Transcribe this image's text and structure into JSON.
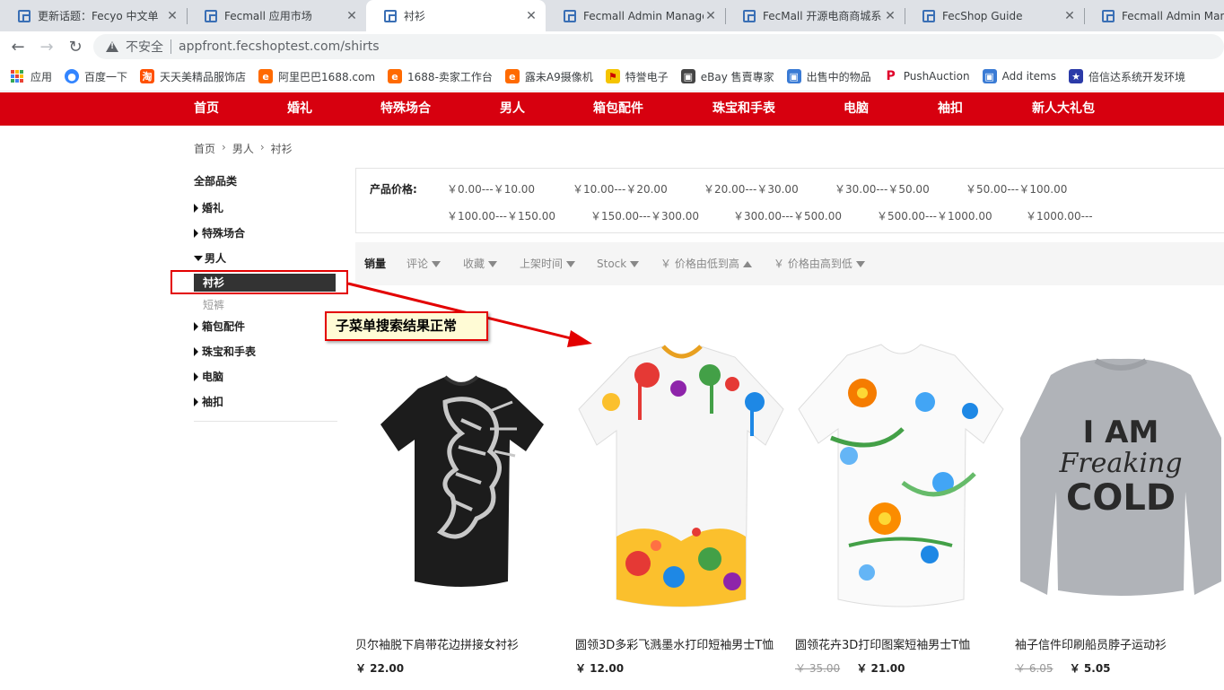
{
  "browser": {
    "tabs": [
      {
        "title": "更新话题：Fecyo 中文单",
        "active": false
      },
      {
        "title": "Fecmall 应用市场",
        "active": false
      },
      {
        "title": "衬衫",
        "active": true
      },
      {
        "title": "Fecmall Admin Manage",
        "active": false
      },
      {
        "title": "FecMall 开源电商商城系",
        "active": false
      },
      {
        "title": "FecShop Guide",
        "active": false
      },
      {
        "title": "Fecmall Admin Mana",
        "active": false
      }
    ],
    "security_label": "不安全",
    "url": "appfront.fecshoptest.com/shirts",
    "bookmarks": [
      {
        "label": "应用",
        "icon": "apps-grid-icon"
      },
      {
        "label": "百度一下",
        "icon": "baidu-paw-icon",
        "color": "#3385ff"
      },
      {
        "label": "天天美精品服饰店",
        "icon": "taobao-icon",
        "color": "#ff5000"
      },
      {
        "label": "阿里巴巴1688.com",
        "icon": "alibaba-icon",
        "color": "#ff6a00"
      },
      {
        "label": "1688-卖家工作台",
        "icon": "alibaba-icon",
        "color": "#ff6a00"
      },
      {
        "label": "露未A9摄像机",
        "icon": "alibaba-icon",
        "color": "#ff6a00"
      },
      {
        "label": "特誉电子",
        "icon": "yellow-flag-icon",
        "color": "#f5c400"
      },
      {
        "label": "eBay 售賣專家",
        "icon": "shopping-bag-icon",
        "color": "#444"
      },
      {
        "label": "出售中的物品",
        "icon": "shopping-bag-icon",
        "color": "#3a7bd5"
      },
      {
        "label": "PushAuction",
        "icon": "pushauction-icon",
        "color": "#e0002a"
      },
      {
        "label": "Add items",
        "icon": "shopping-bag-icon",
        "color": "#3a7bd5"
      },
      {
        "label": "倍信达系统开发环境",
        "icon": "star-badge-icon",
        "color": "#2b3aa8"
      }
    ]
  },
  "site_nav": [
    "首页",
    "婚礼",
    "特殊场合",
    "男人",
    "箱包配件",
    "珠宝和手表",
    "电脑",
    "袖扣",
    "新人大礼包"
  ],
  "breadcrumb": [
    "首页",
    "男人",
    "衬衫"
  ],
  "sidebar": {
    "title": "全部品类",
    "items": [
      {
        "label": "婚礼",
        "expanded": false
      },
      {
        "label": "特殊场合",
        "expanded": false
      },
      {
        "label": "男人",
        "expanded": true
      },
      {
        "label": "箱包配件",
        "expanded": false
      },
      {
        "label": "珠宝和手表",
        "expanded": false
      },
      {
        "label": "电脑",
        "expanded": false
      },
      {
        "label": "袖扣",
        "expanded": false
      }
    ],
    "sub_items": [
      {
        "label": "衬衫",
        "active": true
      },
      {
        "label": "短裤",
        "active": false
      }
    ]
  },
  "annotation": {
    "callout_text": "子菜单搜索结果正常",
    "color": "#e30000"
  },
  "price_filter": {
    "label": "产品价格:",
    "options": [
      "￥0.00---￥10.00",
      "￥10.00---￥20.00",
      "￥20.00---￥30.00",
      "￥30.00---￥50.00",
      "￥50.00---￥100.00",
      "￥100.00---￥150.00",
      "￥150.00---￥300.00",
      "￥300.00---￥500.00",
      "￥500.00---￥1000.00",
      "￥1000.00---"
    ]
  },
  "sort": [
    {
      "label": "销量",
      "active": true,
      "arrow": ""
    },
    {
      "label": "评论",
      "active": false,
      "arrow": "down"
    },
    {
      "label": "收藏",
      "active": false,
      "arrow": "down"
    },
    {
      "label": "上架时间",
      "active": false,
      "arrow": "down"
    },
    {
      "label": "Stock",
      "active": false,
      "arrow": "down"
    },
    {
      "label": "￥ 价格由低到高",
      "active": false,
      "arrow": "up"
    },
    {
      "label": "￥ 价格由高到低",
      "active": false,
      "arrow": "down"
    }
  ],
  "products": [
    {
      "name": "贝尔袖脱下肩带花边拼接女衬衫",
      "old_price": "",
      "price": "￥ 22.00",
      "image": "black-lion-tshirt"
    },
    {
      "name": "圆领3D多彩飞溅墨水打印短袖男士T恤",
      "old_price": "",
      "price": "￥ 12.00",
      "image": "paint-splatter-tshirt"
    },
    {
      "name": "圆领花卉3D打印图案短袖男士T恤",
      "old_price": "￥ 35.00",
      "price": "￥ 21.00",
      "image": "floral-print-tshirt"
    },
    {
      "name": "袖子信件印刷船员脖子运动衫",
      "old_price": "￥ 6.05",
      "price": "￥ 5.05",
      "image": "grey-sweatshirt"
    }
  ],
  "sweatshirt_text": [
    "I AM",
    "Freaking",
    "COLD"
  ],
  "colors": {
    "brand_red": "#d7000f",
    "accent_red": "#e30000"
  }
}
